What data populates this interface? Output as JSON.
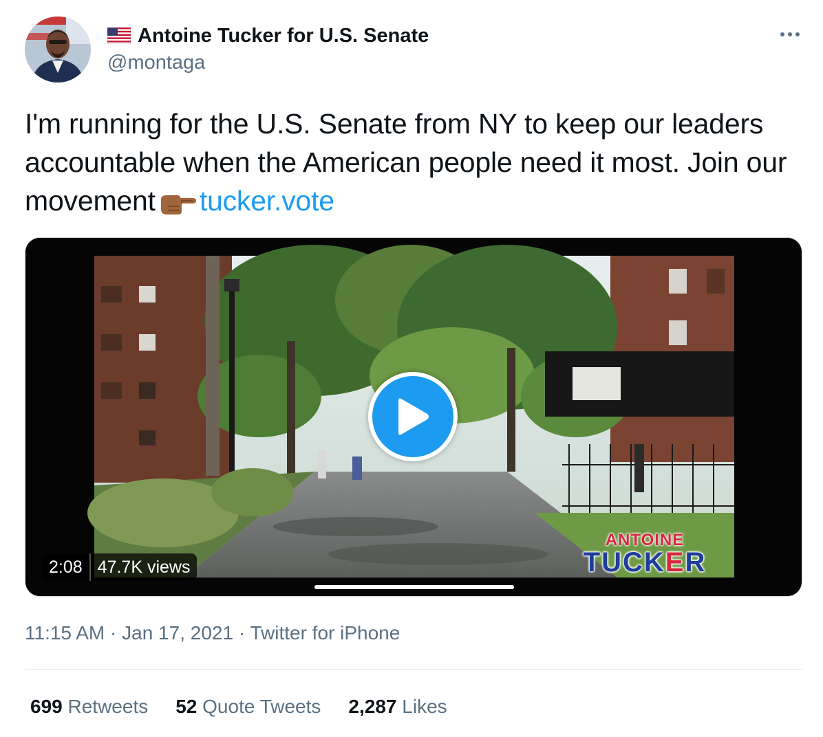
{
  "author": {
    "display_name": "Antoine Tucker for U.S. Senate",
    "handle": "@montaga",
    "flag_icon": "us-flag-icon",
    "avatar_icon": "profile-photo"
  },
  "tweet": {
    "text_main": "I'm running for the U.S. Senate from NY to keep our leaders accountable when the American people need it most. Join our movement",
    "emoji": "pointing-right-hand-emoji",
    "link_text": "tucker.vote"
  },
  "video": {
    "duration": "2:08",
    "views": "47.7K views",
    "overlay_first_name": "ANTOINE",
    "overlay_last_name_a": "TUCK",
    "overlay_last_name_b": "E",
    "overlay_last_name_c": "R",
    "play_icon": "play-icon"
  },
  "meta": {
    "time": "11:15 AM",
    "separator": "·",
    "date": "Jan 17, 2021",
    "source": "Twitter for iPhone"
  },
  "stats": [
    {
      "count": "699",
      "label": "Retweets"
    },
    {
      "count": "52",
      "label": "Quote Tweets"
    },
    {
      "count": "2,287",
      "label": "Likes"
    }
  ],
  "colors": {
    "link": "#1d9bf0",
    "secondary_text": "#5b7083",
    "primary_text": "#0f1419"
  }
}
